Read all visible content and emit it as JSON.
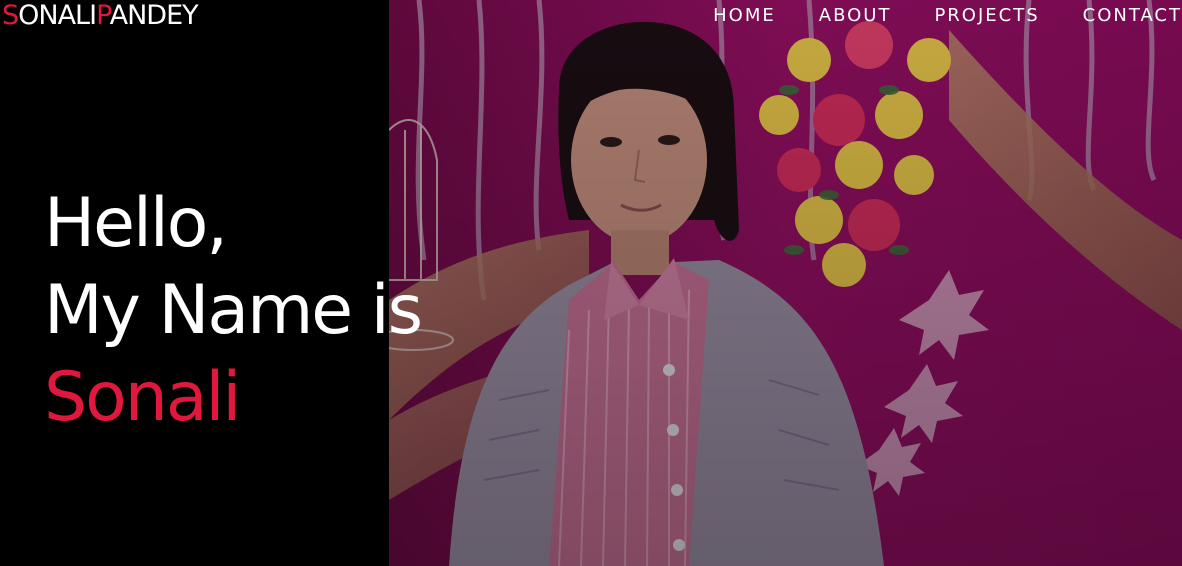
{
  "header": {
    "logo": {
      "first_initial": "S",
      "first_rest": "ONALI",
      "last_initial": "P",
      "last_rest": "ANDEY"
    },
    "nav": {
      "home": "HOME",
      "about": "ABOUT",
      "projects": "PROJECTS",
      "contact": "CONTACT"
    }
  },
  "hero": {
    "greeting": "Hello,",
    "intro": "My Name is",
    "name": "Sonali"
  },
  "colors": {
    "accent": "#e0183d",
    "text": "#ffffff",
    "background": "#000000"
  }
}
